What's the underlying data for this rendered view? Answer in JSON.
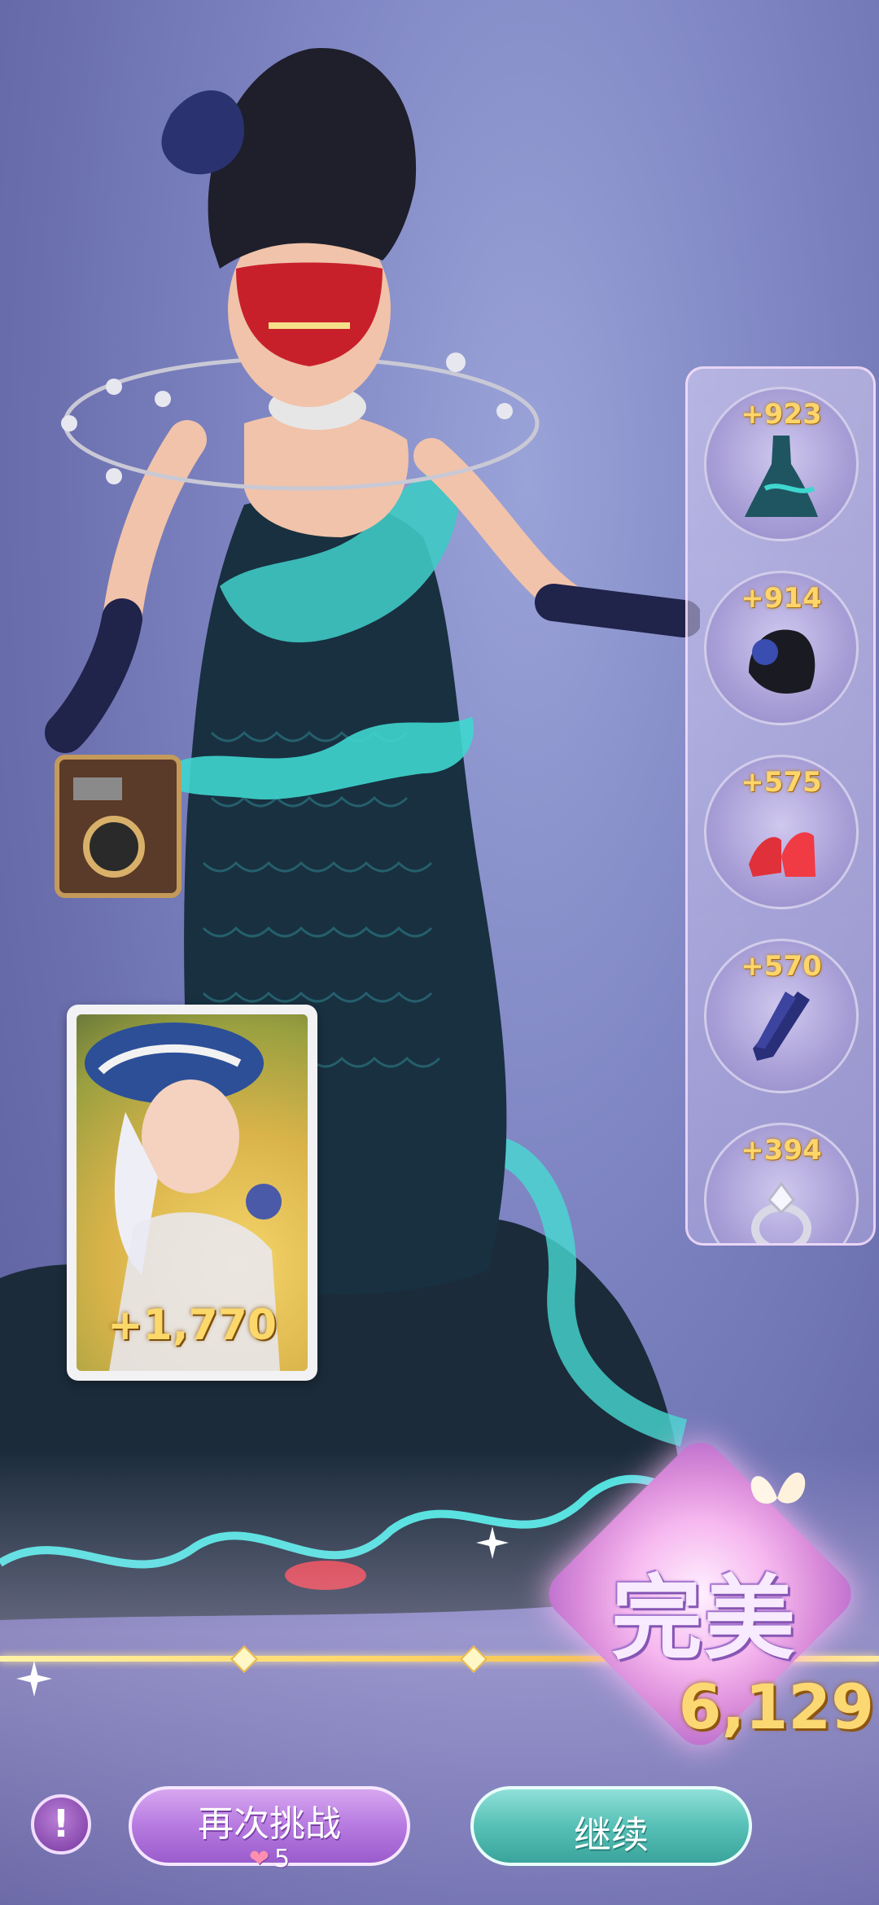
{
  "outfit_items": [
    {
      "name": "dress-item",
      "score": "+923"
    },
    {
      "name": "hat-item",
      "score": "+914"
    },
    {
      "name": "shoes-item",
      "score": "+575"
    },
    {
      "name": "gloves-item",
      "score": "+570"
    },
    {
      "name": "ring-item",
      "score": "+394"
    }
  ],
  "card": {
    "bonus": "+1,770"
  },
  "result": {
    "rating": "完美",
    "total_score": "6,129"
  },
  "buttons": {
    "hint_symbol": "!",
    "retry_label": "再次挑战",
    "retry_cost": "5",
    "continue_label": "继续"
  },
  "colors": {
    "score_gold": "#fcd873",
    "retry_purple": "#b67ae0",
    "continue_teal": "#57c0b6",
    "dress_teal": "#3fd6cf"
  },
  "icons": [
    "camera-prop-icon",
    "heart-icon",
    "sparkle-icon",
    "butterfly-icon"
  ]
}
